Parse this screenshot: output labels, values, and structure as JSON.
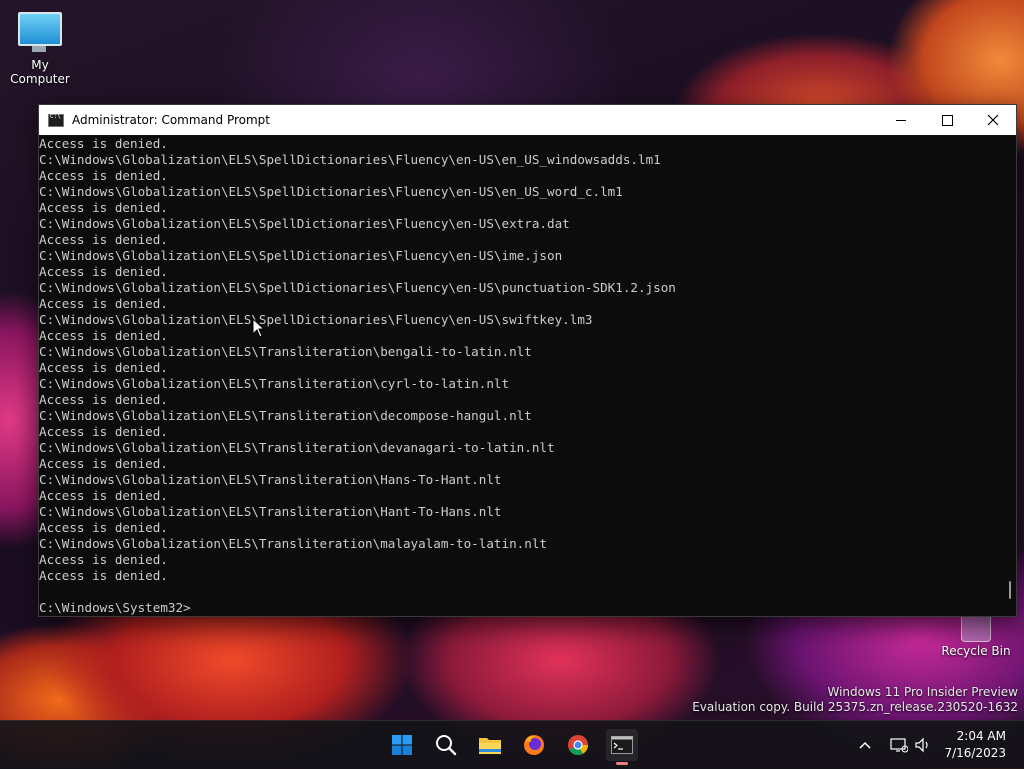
{
  "desktop": {
    "my_computer": "My Computer",
    "recycle_bin": "Recycle Bin",
    "watermark_line1": "Windows 11 Pro Insider Preview",
    "watermark_line2": "Evaluation copy. Build 25375.zn_release.230520-1632"
  },
  "window": {
    "title": "Administrator: Command Prompt",
    "icon": "cmd-icon",
    "controls": {
      "minimize": "minimize-icon",
      "maximize": "maximize-icon",
      "close": "close-icon"
    }
  },
  "console": {
    "lines": [
      "Access is denied.",
      "C:\\Windows\\Globalization\\ELS\\SpellDictionaries\\Fluency\\en-US\\en_US_windowsadds.lm1",
      "Access is denied.",
      "C:\\Windows\\Globalization\\ELS\\SpellDictionaries\\Fluency\\en-US\\en_US_word_c.lm1",
      "Access is denied.",
      "C:\\Windows\\Globalization\\ELS\\SpellDictionaries\\Fluency\\en-US\\extra.dat",
      "Access is denied.",
      "C:\\Windows\\Globalization\\ELS\\SpellDictionaries\\Fluency\\en-US\\ime.json",
      "Access is denied.",
      "C:\\Windows\\Globalization\\ELS\\SpellDictionaries\\Fluency\\en-US\\punctuation-SDK1.2.json",
      "Access is denied.",
      "C:\\Windows\\Globalization\\ELS\\SpellDictionaries\\Fluency\\en-US\\swiftkey.lm3",
      "Access is denied.",
      "C:\\Windows\\Globalization\\ELS\\Transliteration\\bengali-to-latin.nlt",
      "Access is denied.",
      "C:\\Windows\\Globalization\\ELS\\Transliteration\\cyrl-to-latin.nlt",
      "Access is denied.",
      "C:\\Windows\\Globalization\\ELS\\Transliteration\\decompose-hangul.nlt",
      "Access is denied.",
      "C:\\Windows\\Globalization\\ELS\\Transliteration\\devanagari-to-latin.nlt",
      "Access is denied.",
      "C:\\Windows\\Globalization\\ELS\\Transliteration\\Hans-To-Hant.nlt",
      "Access is denied.",
      "C:\\Windows\\Globalization\\ELS\\Transliteration\\Hant-To-Hans.nlt",
      "Access is denied.",
      "C:\\Windows\\Globalization\\ELS\\Transliteration\\malayalam-to-latin.nlt",
      "Access is denied.",
      "Access is denied.",
      "",
      "C:\\Windows\\System32>"
    ]
  },
  "taskbar": {
    "apps": [
      "windows-start-icon",
      "search-icon",
      "file-explorer-icon",
      "firefox-icon",
      "chrome-icon",
      "terminal-icon"
    ],
    "tray": [
      "chevron-up-icon",
      "network-icon",
      "volume-icon"
    ],
    "time": "2:04 AM",
    "date": "7/16/2023",
    "colors": {
      "start_blue": "#0078d4",
      "active_indicator": "#f08080"
    }
  }
}
